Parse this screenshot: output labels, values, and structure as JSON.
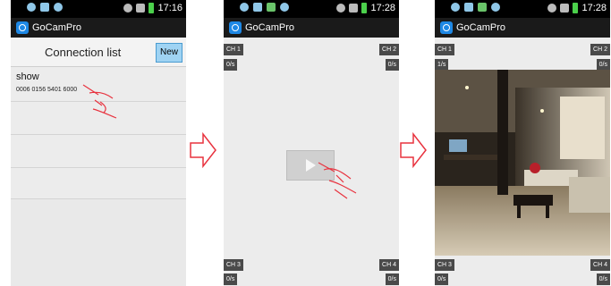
{
  "app": {
    "title": "GoCamPro"
  },
  "status_times": [
    "17:16",
    "17:28",
    "17:28"
  ],
  "panel1": {
    "header": "Connection list",
    "new_label": "New",
    "items": [
      {
        "name": "show",
        "id": "0006 0156 5401 6000"
      }
    ]
  },
  "channels": {
    "ch1": {
      "label": "CH 1",
      "rate": "0/s"
    },
    "ch2": {
      "label": "CH 2",
      "rate": "0/s"
    },
    "ch3": {
      "label": "CH 3",
      "rate": "0/s"
    },
    "ch4": {
      "label": "CH 4",
      "rate": "0/s"
    }
  },
  "panel3_ch1_rate": "1/s",
  "colors": {
    "arrow": "#e8333f",
    "accent": "#1e88e5",
    "new_button": "#9fd3f3"
  },
  "icons": [
    "hand-pointer-icon",
    "play-icon",
    "arrow-right-icon"
  ]
}
